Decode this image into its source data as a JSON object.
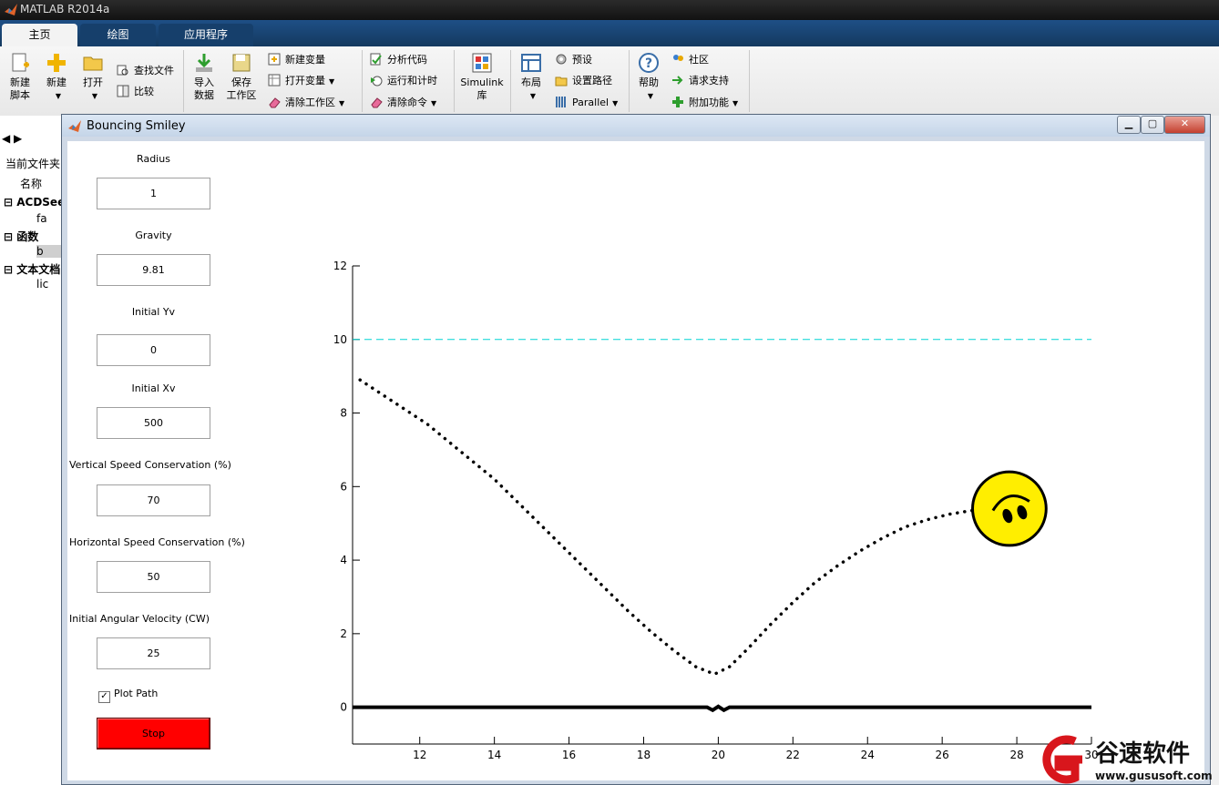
{
  "app": {
    "title": "MATLAB R2014a"
  },
  "ribbon_tabs": [
    {
      "label": "主页",
      "active": true
    },
    {
      "label": "绘图",
      "active": false
    },
    {
      "label": "应用程序",
      "active": false
    }
  ],
  "ribbon": {
    "new_script": "新建\n脚本",
    "new": "新建",
    "open": "打开",
    "find_files": "查找文件",
    "compare": "比较",
    "import_data": "导入\n数据",
    "save_workspace": "保存\n工作区",
    "new_variable": "新建变量",
    "open_variable": "打开变量",
    "clear_workspace": "清除工作区",
    "analyze_code": "分析代码",
    "run_and_time": "运行和计时",
    "clear_commands": "清除命令",
    "simulink": "Simulink\n库",
    "layout": "布局",
    "preferences": "预设",
    "set_path": "设置路径",
    "parallel": "Parallel",
    "help": "帮助",
    "community": "社区",
    "request_support": "请求支持",
    "add_ons": "附加功能"
  },
  "left_panel": {
    "current_folder": "当前文件夹",
    "name_col": "名称",
    "groups": [
      {
        "label": "ACDSee",
        "item": "fa"
      },
      {
        "label": "函数",
        "item": "b"
      },
      {
        "label": "文本文档",
        "item": "lic"
      }
    ]
  },
  "figure": {
    "title": "Bouncing Smiley",
    "controls": [
      {
        "label": "Radius",
        "value": "1"
      },
      {
        "label": "Gravity",
        "value": "9.81"
      },
      {
        "label": "Initial Yv",
        "value": "0"
      },
      {
        "label": "Initial Xv",
        "value": "500"
      },
      {
        "label": "Vertical Speed Conservation (%)",
        "value": "70"
      },
      {
        "label": "Horizontal Speed Conservation (%)",
        "value": "50"
      },
      {
        "label": "Initial Angular Velocity (CW)",
        "value": "25"
      }
    ],
    "plot_path": {
      "label": "Plot Path",
      "checked": true
    },
    "stop_button": "Stop"
  },
  "chart_data": {
    "type": "line",
    "xlim": [
      10.2,
      30
    ],
    "ylim": [
      -1,
      12
    ],
    "x_ticks": [
      12,
      14,
      16,
      18,
      20,
      22,
      24,
      26,
      28,
      30
    ],
    "x_tick_labels": [
      "12",
      "14",
      "16",
      "18",
      "20",
      "22",
      "24",
      "26",
      "28",
      "30"
    ],
    "y_ticks": [
      0,
      2,
      4,
      6,
      8,
      10,
      12
    ],
    "y_tick_labels": [
      "0",
      "2",
      "4",
      "6",
      "8",
      "10",
      "12"
    ],
    "grid": false,
    "series": [
      {
        "style": "dotted",
        "color": "#000000",
        "x": [
          10.4,
          11.0,
          11.6,
          12.2,
          12.8,
          13.4,
          14.0,
          14.6,
          15.2,
          15.8,
          16.4,
          17.0,
          17.6,
          18.2,
          18.8,
          19.4,
          19.9,
          20.3,
          20.8,
          21.4,
          22.0,
          22.6,
          23.2,
          23.8,
          24.4,
          25.0,
          25.6,
          26.2,
          26.8,
          27.2
        ],
        "y": [
          8.9,
          8.5,
          8.1,
          7.7,
          7.2,
          6.7,
          6.2,
          5.6,
          5.0,
          4.4,
          3.8,
          3.2,
          2.6,
          2.05,
          1.55,
          1.1,
          0.9,
          1.1,
          1.6,
          2.25,
          2.85,
          3.4,
          3.85,
          4.25,
          4.6,
          4.9,
          5.1,
          5.25,
          5.35,
          5.4
        ]
      },
      {
        "style": "dashed",
        "color": "#00d4d4",
        "x": [
          10.2,
          30
        ],
        "y": [
          10,
          10
        ]
      },
      {
        "style": "solid-thick",
        "color": "#000000",
        "x": [
          10.2,
          19.7,
          19.85,
          20.0,
          20.15,
          20.3,
          30
        ],
        "y": [
          0,
          0,
          -0.08,
          0.02,
          -0.08,
          0,
          0
        ]
      }
    ],
    "annotations": [
      {
        "type": "smiley",
        "x": 27.8,
        "y": 5.4,
        "radius": 1.0,
        "color": "#ffee00"
      }
    ]
  },
  "watermark": {
    "brand": "谷速软件",
    "url": "www.gususoft.com"
  }
}
